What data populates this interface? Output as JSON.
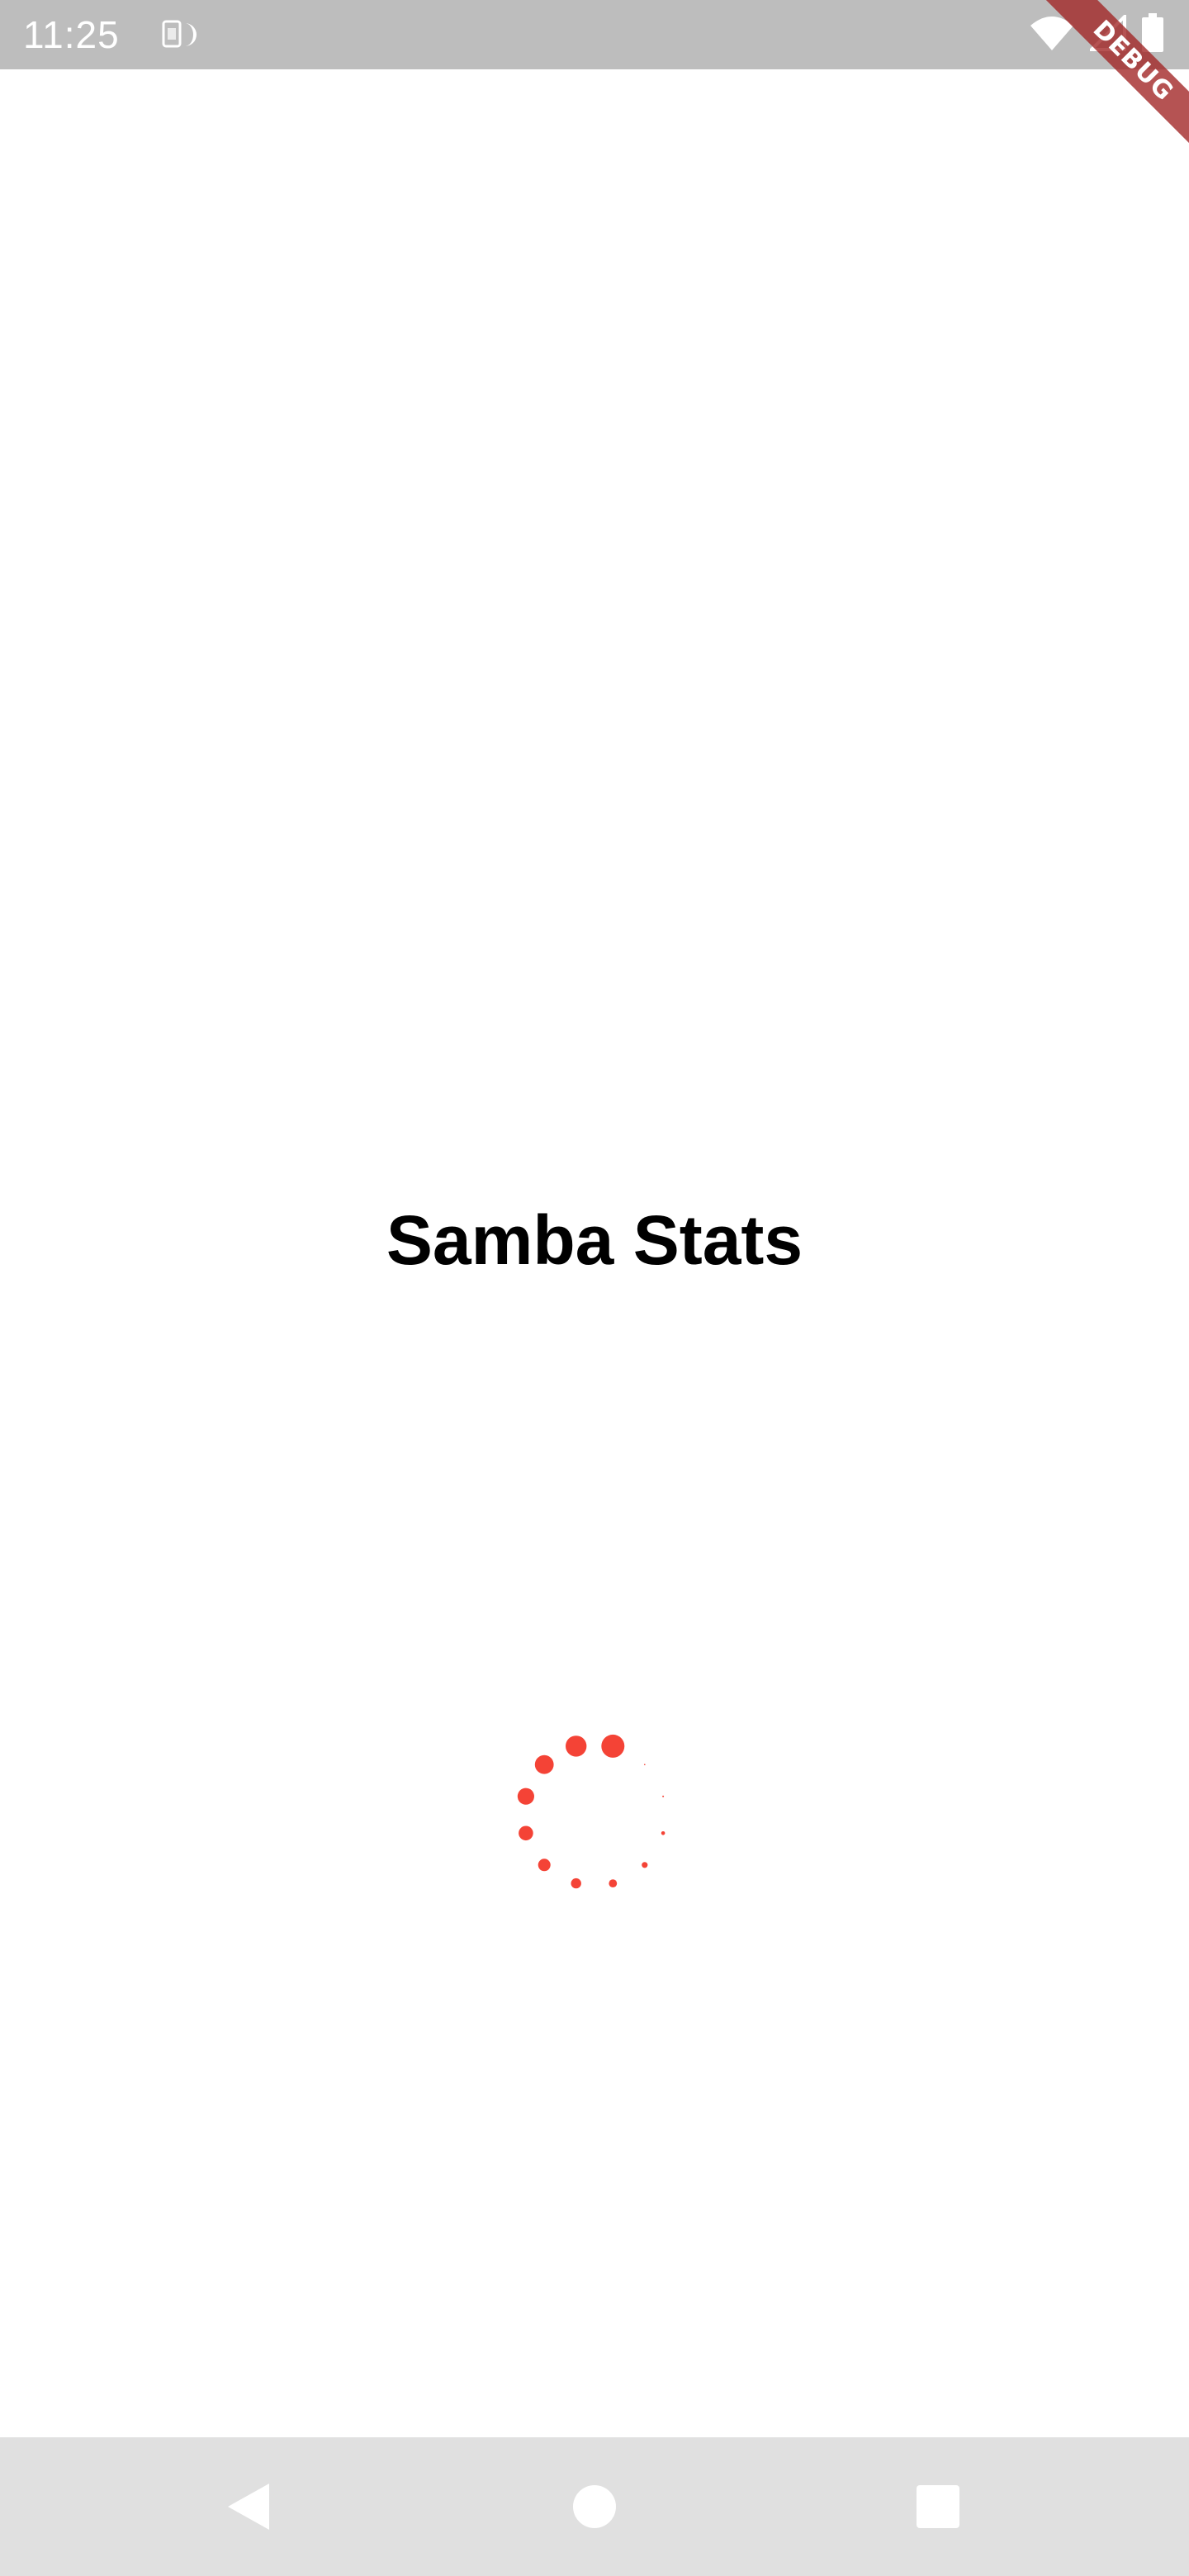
{
  "status_bar": {
    "time": "11:25",
    "left_icon": "sim-card-icon",
    "right_icons": [
      "wifi-icon",
      "cellular-signal-icon",
      "battery-icon"
    ],
    "background_color": "#bdbdbd"
  },
  "debug_banner": {
    "label": "DEBUG",
    "color": "#a02222"
  },
  "splash": {
    "title": "Samba Stats",
    "loading_indicator": "spinning-dots-icon",
    "accent_color": "#f44336"
  },
  "navigation_bar": {
    "back_icon": "back-triangle-icon",
    "home_icon": "home-circle-icon",
    "recents_icon": "recents-square-icon"
  }
}
